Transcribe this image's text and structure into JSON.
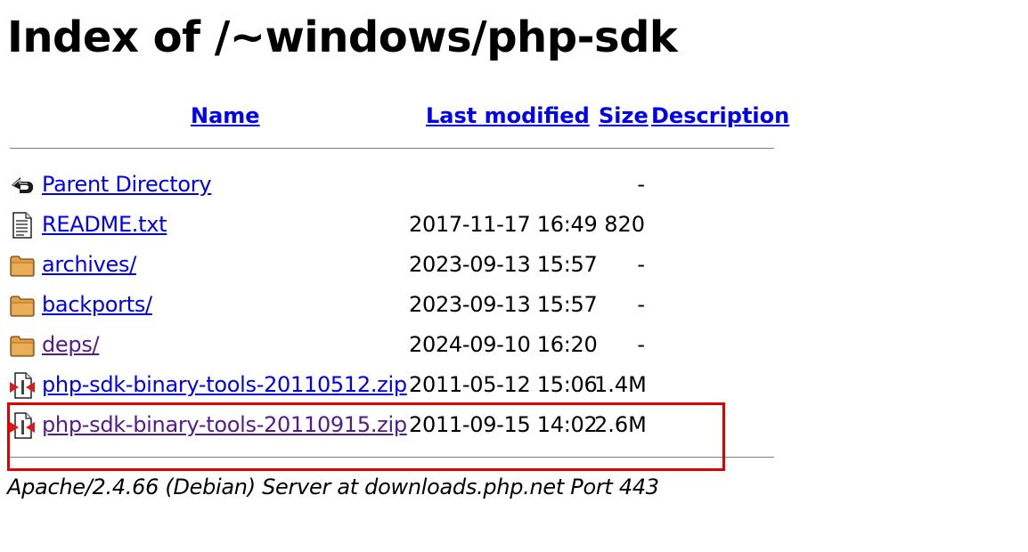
{
  "page": {
    "title": "Index of /~windows/php-sdk"
  },
  "table": {
    "headers": {
      "name": "Name",
      "last_modified": "Last modified",
      "size": "Size",
      "description": "Description"
    },
    "rows": [
      {
        "icon": "back-arrow-icon",
        "name": "Parent Directory",
        "modified": "",
        "size": "-",
        "visited": false
      },
      {
        "icon": "text-file-icon",
        "name": "README.txt",
        "modified": "2017-11-17 16:49",
        "size": "820",
        "visited": false
      },
      {
        "icon": "folder-icon",
        "name": "archives/",
        "modified": "2023-09-13 15:57",
        "size": "-",
        "visited": false
      },
      {
        "icon": "folder-icon",
        "name": "backports/",
        "modified": "2023-09-13 15:57",
        "size": "-",
        "visited": false
      },
      {
        "icon": "folder-icon",
        "name": "deps/",
        "modified": "2024-09-10 16:20",
        "size": "-",
        "visited": true
      },
      {
        "icon": "compressed-file-icon",
        "name": "php-sdk-binary-tools-20110512.zip",
        "modified": "2011-05-12 15:06",
        "size": "1.4M",
        "visited": false
      },
      {
        "icon": "compressed-file-icon",
        "name": "php-sdk-binary-tools-20110915.zip",
        "modified": "2011-09-15 14:02",
        "size": "2.6M",
        "visited": true
      }
    ]
  },
  "footer": {
    "address": "Apache/2.4.66 (Debian) Server at downloads.php.net Port 443"
  },
  "colors": {
    "link": "#0000ee",
    "visited_link": "#551a8b",
    "highlight_box": "#e00000",
    "rule": "#808080"
  }
}
